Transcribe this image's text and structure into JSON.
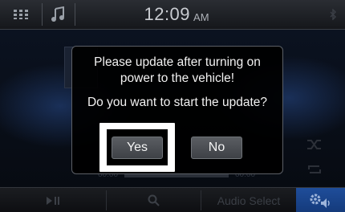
{
  "status_bar": {
    "time": "12:09",
    "ampm": "AM"
  },
  "player": {
    "elapsed": "00:00",
    "remaining": "00:00"
  },
  "bottom_bar": {
    "audio_select_label": "Audio Select"
  },
  "dialog": {
    "line1": "Please update after turning on",
    "line2": "power to the vehicle!",
    "question": "Do you want to start the update?",
    "yes_label": "Yes",
    "no_label": "No"
  },
  "colors": {
    "accent": "#1f4d9a",
    "focus": "#ffffff"
  },
  "icons": [
    "apps-grid-icon",
    "music-source-icon",
    "shuffle-icon",
    "repeat-icon",
    "play-pause-icon",
    "search-icon",
    "settings-volume-icon"
  ]
}
